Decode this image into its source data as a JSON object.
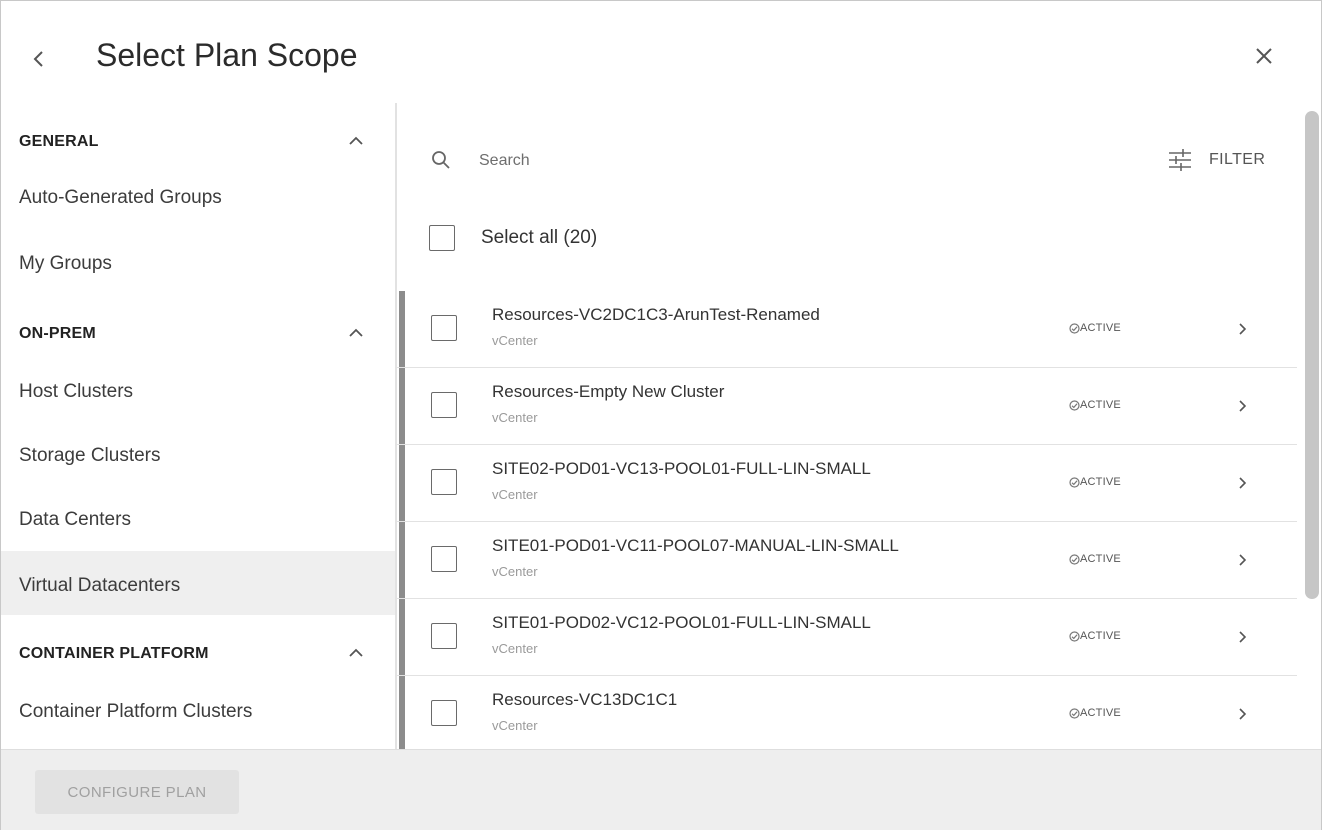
{
  "header": {
    "back_icon": "chevron-left-icon",
    "title": "Select Plan Scope",
    "close_icon": "close-icon"
  },
  "sidebar": {
    "groups": [
      {
        "label": "GENERAL",
        "expanded": true,
        "items": [
          {
            "label": "Auto-Generated Groups",
            "selected": false
          },
          {
            "label": "My Groups",
            "selected": false
          }
        ]
      },
      {
        "label": "ON-PREM",
        "expanded": true,
        "items": [
          {
            "label": "Host Clusters",
            "selected": false
          },
          {
            "label": "Storage Clusters",
            "selected": false
          },
          {
            "label": "Data Centers",
            "selected": false
          },
          {
            "label": "Virtual Datacenters",
            "selected": true
          }
        ]
      },
      {
        "label": "CONTAINER PLATFORM",
        "expanded": true,
        "items": [
          {
            "label": "Container Platform Clusters",
            "selected": false
          }
        ]
      }
    ]
  },
  "search": {
    "placeholder": "Search",
    "value": ""
  },
  "filter": {
    "label": "FILTER",
    "icon": "filter-sliders-icon"
  },
  "select_all": {
    "label": "Select all (20)",
    "checked": false
  },
  "rows": [
    {
      "name": "Resources-VC2DC1C3-ArunTest-Renamed",
      "source": "vCenter",
      "status": "ACTIVE",
      "checked": false
    },
    {
      "name": "Resources-Empty New Cluster",
      "source": "vCenter",
      "status": "ACTIVE",
      "checked": false
    },
    {
      "name": "SITE02-POD01-VC13-POOL01-FULL-LIN-SMALL",
      "source": "vCenter",
      "status": "ACTIVE",
      "checked": false
    },
    {
      "name": "SITE01-POD01-VC11-POOL07-MANUAL-LIN-SMALL",
      "source": "vCenter",
      "status": "ACTIVE",
      "checked": false
    },
    {
      "name": "SITE01-POD02-VC12-POOL01-FULL-LIN-SMALL",
      "source": "vCenter",
      "status": "ACTIVE",
      "checked": false
    },
    {
      "name": "Resources-VC13DC1C1",
      "source": "vCenter",
      "status": "ACTIVE",
      "checked": false
    }
  ],
  "footer": {
    "configure_label": "CONFIGURE PLAN",
    "configure_enabled": false
  },
  "colors": {
    "selected_bg": "#efefef",
    "row_accent": "#8c8c8c",
    "footer_bg": "#eeeeee",
    "disabled_text": "#a0a0a0"
  }
}
